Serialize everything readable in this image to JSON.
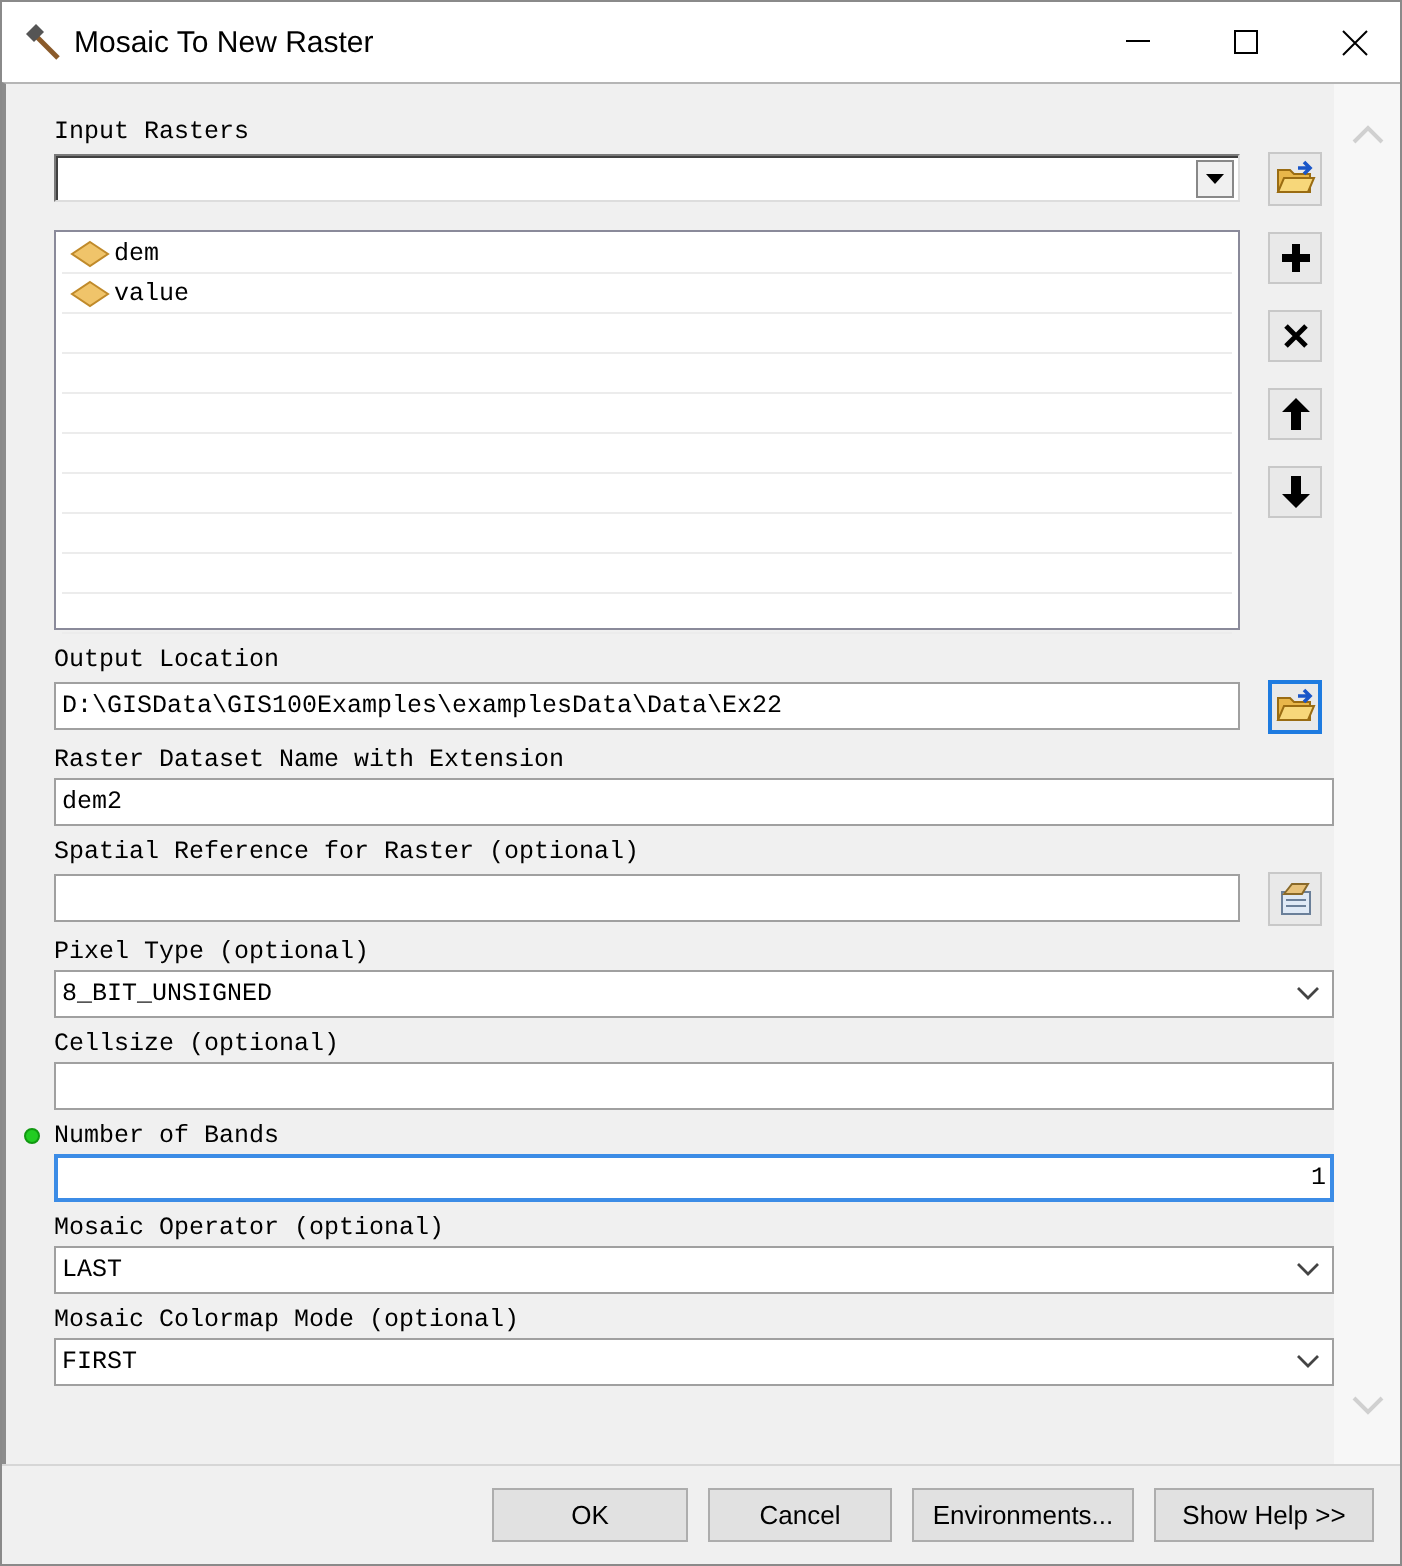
{
  "window": {
    "title": "Mosaic To New Raster"
  },
  "parameters": [
    {
      "kind": "multivalue",
      "label": "Input Rasters",
      "dot": false,
      "focused": false,
      "browse": {
        "focused": false
      },
      "items": [
        {
          "name": "dem"
        },
        {
          "name": "value"
        }
      ]
    },
    {
      "kind": "text",
      "label": "Output Location",
      "dot": false,
      "focused": false,
      "value": "D:\\GISData\\GIS100Examples\\examplesData\\Data\\Ex22",
      "browse": {
        "focused": true
      }
    },
    {
      "kind": "text",
      "label": "Raster Dataset Name with Extension",
      "dot": false,
      "focused": false,
      "value": "dem2"
    },
    {
      "kind": "text",
      "label": "Spatial Reference for Raster (optional)",
      "dot": false,
      "focused": false,
      "browse": {
        "focused": false
      }
    },
    {
      "kind": "dropdown",
      "label": "Pixel Type (optional)",
      "dot": false,
      "focused": false,
      "value": "8_BIT_UNSIGNED"
    },
    {
      "kind": "text",
      "label": "Cellsize (optional)",
      "dot": false,
      "focused": false
    },
    {
      "kind": "number",
      "label": "Number of Bands",
      "dot": true,
      "focused": true,
      "value": "1"
    },
    {
      "kind": "dropdown",
      "label": "Mosaic Operator (optional)",
      "dot": false,
      "focused": false,
      "value": "LAST"
    },
    {
      "kind": "dropdown",
      "label": "Mosaic Colormap Mode (optional)",
      "dot": false,
      "focused": false,
      "value": "FIRST"
    }
  ],
  "buttons": [
    "OK",
    "Cancel",
    "Environments...",
    "Show Help >>"
  ]
}
